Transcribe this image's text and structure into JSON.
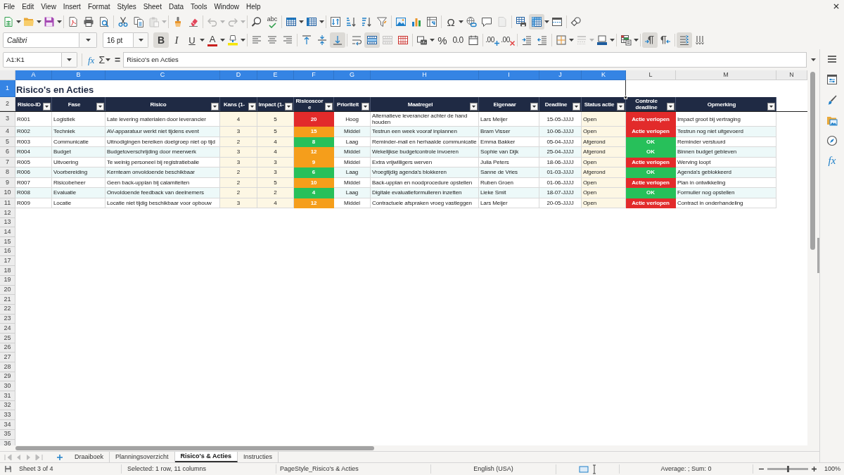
{
  "menu_bar": [
    "File",
    "Edit",
    "View",
    "Insert",
    "Format",
    "Styles",
    "Sheet",
    "Data",
    "Tools",
    "Window",
    "Help"
  ],
  "standard_toolbar": [
    [
      {
        "kind": "new_document",
        "on": false,
        "disabled": false
      },
      {
        "kind": "open",
        "on": false,
        "disabled": false
      },
      {
        "kind": "save",
        "on": false,
        "disabled": false
      }
    ],
    [
      {
        "kind": "export_pdf",
        "on": false,
        "disabled": false
      },
      {
        "kind": "print",
        "on": false,
        "disabled": false
      },
      {
        "kind": "print_preview",
        "on": false,
        "disabled": false
      }
    ],
    [
      {
        "kind": "cut",
        "on": false,
        "disabled": false
      },
      {
        "kind": "copy",
        "on": false,
        "disabled": false
      },
      {
        "kind": "paste",
        "on": false,
        "disabled": true
      }
    ],
    [
      {
        "kind": "clone_formatting",
        "on": false,
        "disabled": false
      },
      {
        "kind": "clear_formatting",
        "on": false,
        "disabled": false
      }
    ],
    [
      {
        "kind": "undo",
        "on": false,
        "disabled": true
      },
      {
        "kind": "redo",
        "on": false,
        "disabled": true
      }
    ],
    [
      {
        "kind": "find_replace",
        "on": false,
        "disabled": false
      },
      {
        "kind": "spelling",
        "text": "abc",
        "on": false,
        "disabled": false
      }
    ],
    [
      {
        "kind": "insert_rows",
        "on": false,
        "disabled": false
      },
      {
        "kind": "insert_columns",
        "on": false,
        "disabled": false
      }
    ],
    [
      {
        "kind": "sort",
        "on": false,
        "disabled": false
      },
      {
        "kind": "sort_ascending",
        "on": false,
        "disabled": false
      },
      {
        "kind": "sort_descending",
        "on": false,
        "disabled": false
      },
      {
        "kind": "autofilter",
        "on": false,
        "disabled": false
      }
    ],
    [
      {
        "kind": "image",
        "on": false,
        "disabled": false
      },
      {
        "kind": "chart",
        "on": false,
        "disabled": false
      },
      {
        "kind": "pivot_table",
        "on": false,
        "disabled": false
      }
    ],
    [
      {
        "kind": "special_character",
        "text": "Ω",
        "on": false,
        "disabled": false
      },
      {
        "kind": "hyperlink",
        "on": false,
        "disabled": false
      },
      {
        "kind": "comment",
        "on": false,
        "disabled": false
      },
      {
        "kind": "header_footer",
        "on": false,
        "disabled": true
      }
    ],
    [
      {
        "kind": "print_area",
        "on": false,
        "disabled": false
      },
      {
        "kind": "freeze",
        "on": true,
        "disabled": false
      },
      {
        "kind": "split_window",
        "on": false,
        "disabled": false
      }
    ],
    [
      {
        "kind": "draw_functions",
        "on": false,
        "disabled": false
      }
    ]
  ],
  "formatting_toolbar": {
    "font_name": "Calibri",
    "font_size": "16 pt",
    "groups": [
      [
        {
          "kind": "bold",
          "text": "B",
          "on": true,
          "disabled": false
        },
        {
          "kind": "italic",
          "text": "I",
          "on": false,
          "disabled": false
        },
        {
          "kind": "underline",
          "text": "U",
          "on": false,
          "disabled": false
        },
        {
          "kind": "font_color",
          "text": "A",
          "on": false,
          "disabled": false
        },
        {
          "kind": "highlight",
          "on": false,
          "disabled": false
        }
      ],
      [
        {
          "kind": "align_left",
          "on": false,
          "disabled": false
        },
        {
          "kind": "align_center",
          "on": false,
          "disabled": false
        },
        {
          "kind": "align_right",
          "on": false,
          "disabled": false
        }
      ],
      [
        {
          "kind": "align_top",
          "on": false,
          "disabled": false
        },
        {
          "kind": "align_middle",
          "on": false,
          "disabled": false
        },
        {
          "kind": "align_bottom",
          "on": true,
          "disabled": false
        }
      ],
      [
        {
          "kind": "wrap_text",
          "on": false,
          "disabled": false
        },
        {
          "kind": "merge_center",
          "on": true,
          "disabled": false
        },
        {
          "kind": "merge_cells",
          "on": false,
          "disabled": true
        },
        {
          "kind": "unmerge_cells",
          "on": false,
          "disabled": false
        }
      ],
      [
        {
          "kind": "number_format",
          "on": false,
          "disabled": false
        },
        {
          "kind": "percent_format",
          "text": "%",
          "on": false,
          "disabled": false
        },
        {
          "kind": "standard_format",
          "text": "0.0",
          "on": false,
          "disabled": false
        },
        {
          "kind": "date_format",
          "on": false,
          "disabled": false
        }
      ],
      [
        {
          "kind": "add_decimal",
          "text": ".00",
          "on": false,
          "disabled": false
        },
        {
          "kind": "delete_decimal",
          "text": ".00",
          "on": false,
          "disabled": false
        }
      ],
      [
        {
          "kind": "increase_indent",
          "on": false,
          "disabled": false
        },
        {
          "kind": "decrease_indent",
          "on": false,
          "disabled": false
        }
      ],
      [
        {
          "kind": "borders",
          "on": false,
          "disabled": false
        },
        {
          "kind": "border_style",
          "on": false,
          "disabled": true
        },
        {
          "kind": "border_color",
          "on": false,
          "disabled": false
        }
      ],
      [
        {
          "kind": "conditional_format",
          "on": false,
          "disabled": false
        }
      ],
      [
        {
          "kind": "left_to_right",
          "on": true,
          "disabled": false
        },
        {
          "kind": "right_to_left",
          "on": false,
          "disabled": false
        }
      ],
      [
        {
          "kind": "text_horizontal",
          "on": true,
          "disabled": false
        },
        {
          "kind": "text_vertical",
          "on": false,
          "disabled": false
        }
      ]
    ]
  },
  "formula_bar": {
    "name_box": "A1:K1",
    "function_wizard": "fx",
    "sum": "Σ",
    "formula": "=",
    "content": "Risico's en Acties"
  },
  "column_headers": [
    {
      "label": "A",
      "selected": true
    },
    {
      "label": "B",
      "selected": true
    },
    {
      "label": "C",
      "selected": true
    },
    {
      "label": "D",
      "selected": true
    },
    {
      "label": "E",
      "selected": true
    },
    {
      "label": "F",
      "selected": true
    },
    {
      "label": "G",
      "selected": true
    },
    {
      "label": "H",
      "selected": true
    },
    {
      "label": "I",
      "selected": true
    },
    {
      "label": "J",
      "selected": true
    },
    {
      "label": "K",
      "selected": true
    },
    {
      "label": "L",
      "selected": false
    },
    {
      "label": "M",
      "selected": false
    },
    {
      "label": "N",
      "selected": false
    }
  ],
  "row_headers": [
    {
      "label": "1",
      "selected": true
    },
    {
      "label": "2",
      "selected": false
    },
    {
      "label": "3",
      "selected": false
    },
    {
      "label": "4",
      "selected": false
    },
    {
      "label": "5",
      "selected": false
    },
    {
      "label": "6",
      "selected": false
    },
    {
      "label": "7",
      "selected": false
    },
    {
      "label": "8",
      "selected": false
    },
    {
      "label": "9",
      "selected": false
    },
    {
      "label": "10",
      "selected": false
    },
    {
      "label": "11",
      "selected": false
    },
    {
      "label": "12",
      "selected": false
    },
    {
      "label": "13",
      "selected": false
    },
    {
      "label": "14",
      "selected": false
    },
    {
      "label": "15",
      "selected": false
    },
    {
      "label": "16",
      "selected": false
    },
    {
      "label": "17",
      "selected": false
    },
    {
      "label": "18",
      "selected": false
    },
    {
      "label": "19",
      "selected": false
    },
    {
      "label": "20",
      "selected": false
    },
    {
      "label": "21",
      "selected": false
    },
    {
      "label": "22",
      "selected": false
    },
    {
      "label": "23",
      "selected": false
    },
    {
      "label": "24",
      "selected": false
    },
    {
      "label": "25",
      "selected": false
    },
    {
      "label": "26",
      "selected": false
    },
    {
      "label": "27",
      "selected": false
    },
    {
      "label": "28",
      "selected": false
    },
    {
      "label": "29",
      "selected": false
    },
    {
      "label": "30",
      "selected": false
    },
    {
      "label": "31",
      "selected": false
    },
    {
      "label": "32",
      "selected": false
    },
    {
      "label": "33",
      "selected": false
    },
    {
      "label": "34",
      "selected": false
    },
    {
      "label": "35",
      "selected": false
    },
    {
      "label": "36",
      "selected": false
    }
  ],
  "sheet": {
    "title": "Risico's en Acties",
    "table": {
      "columns": [
        "Risico-ID",
        "Fase",
        "Risico",
        "Kans (1-",
        "Impact (1-",
        "Risicoscore",
        "Prioriteit",
        "Maatregel",
        "Eigenaar",
        "Deadline",
        "Status actie",
        "Controle deadline",
        "Opmerking"
      ],
      "rows": [
        {
          "id": "R001",
          "phase": "Logistiek",
          "risk": "Late levering materialen door leverancier",
          "likelihood": "4",
          "impact": "5",
          "score": {
            "value": "20",
            "color": "#e22b2b"
          },
          "priority": "Hoog",
          "measure": "Alternatieve leverancier achter de hand houden",
          "owner": "Lars Meijer",
          "deadline": "15-05-JJJJ",
          "status": "Open",
          "deadline_check": {
            "value": "Actie verlopen",
            "color": "#e22b2b"
          },
          "remark": "Impact groot bij vertraging"
        },
        {
          "id": "R002",
          "phase": "Techniek",
          "risk": "AV-apparatuur werkt niet tijdens event",
          "likelihood": "3",
          "impact": "5",
          "score": {
            "value": "15",
            "color": "#f59e1b"
          },
          "priority": "Middel",
          "measure": "Testrun een week vooraf inplannen",
          "owner": "Bram Visser",
          "deadline": "10-06-JJJJ",
          "status": "Open",
          "deadline_check": {
            "value": "Actie verlopen",
            "color": "#e22b2b"
          },
          "remark": "Testrun nog niet uitgevoerd"
        },
        {
          "id": "R003",
          "phase": "Communicatie",
          "risk": "Uitnodigingen bereiken doelgroep niet op tijd",
          "likelihood": "2",
          "impact": "4",
          "score": {
            "value": "8",
            "color": "#27c05a"
          },
          "priority": "Laag",
          "measure": "Reminder-mail en herhaalde communicatie",
          "owner": "Emma Bakker",
          "deadline": "05-04-JJJJ",
          "status": "Afgerond",
          "deadline_check": {
            "value": "OK",
            "color": "#27c05a"
          },
          "remark": "Reminder verstuurd"
        },
        {
          "id": "R004",
          "phase": "Budget",
          "risk": "Budgetoverschrijding door meerwerk",
          "likelihood": "3",
          "impact": "4",
          "score": {
            "value": "12",
            "color": "#f59e1b"
          },
          "priority": "Middel",
          "measure": "Wekelijkse budgetcontrole invoeren",
          "owner": "Sophie van Dijk",
          "deadline": "25-04-JJJJ",
          "status": "Afgerond",
          "deadline_check": {
            "value": "OK",
            "color": "#27c05a"
          },
          "remark": "Binnen budget gebleven"
        },
        {
          "id": "R005",
          "phase": "Uitvoering",
          "risk": "Te weinig personeel bij registratiebalie",
          "likelihood": "3",
          "impact": "3",
          "score": {
            "value": "9",
            "color": "#f59e1b"
          },
          "priority": "Middel",
          "measure": "Extra vrijwilligers werven",
          "owner": "Julia Peters",
          "deadline": "18-06-JJJJ",
          "status": "Open",
          "deadline_check": {
            "value": "Actie verlopen",
            "color": "#e22b2b"
          },
          "remark": "Werving loopt"
        },
        {
          "id": "R006",
          "phase": "Voorbereiding",
          "risk": "Kernteam onvoldoende beschikbaar",
          "likelihood": "2",
          "impact": "3",
          "score": {
            "value": "6",
            "color": "#27c05a"
          },
          "priority": "Laag",
          "measure": "Vroegtijdig agenda's blokkeren",
          "owner": "Sanne de Vries",
          "deadline": "01-03-JJJJ",
          "status": "Afgerond",
          "deadline_check": {
            "value": "OK",
            "color": "#27c05a"
          },
          "remark": "Agenda's geblokkeerd"
        },
        {
          "id": "R007",
          "phase": "Risicobeheer",
          "risk": "Geen back-upplan bij calamiteiten",
          "likelihood": "2",
          "impact": "5",
          "score": {
            "value": "10",
            "color": "#f59e1b"
          },
          "priority": "Middel",
          "measure": "Back-upplan en noodprocedure opstellen",
          "owner": "Ruben Groen",
          "deadline": "01-06-JJJJ",
          "status": "Open",
          "deadline_check": {
            "value": "Actie verlopen",
            "color": "#e22b2b"
          },
          "remark": "Plan in ontwikkeling"
        },
        {
          "id": "R008",
          "phase": "Evaluatie",
          "risk": "Onvoldoende feedback van deelnemers",
          "likelihood": "2",
          "impact": "2",
          "score": {
            "value": "4",
            "color": "#27c05a"
          },
          "priority": "Laag",
          "measure": "Digitale evaluatieformulieren inzetten",
          "owner": "Lieke Smit",
          "deadline": "18-07-JJJJ",
          "status": "Open",
          "deadline_check": {
            "value": "OK",
            "color": "#27c05a"
          },
          "remark": "Formulier nog opstellen"
        },
        {
          "id": "R009",
          "phase": "Locatie",
          "risk": "Locatie niet tijdig beschikbaar voor opbouw",
          "likelihood": "3",
          "impact": "4",
          "score": {
            "value": "12",
            "color": "#f59e1b"
          },
          "priority": "Middel",
          "measure": "Contractuele afspraken vroeg vastleggen",
          "owner": "Lars Meijer",
          "deadline": "20-05-JJJJ",
          "status": "Open",
          "deadline_check": {
            "value": "Actie verlopen",
            "color": "#e22b2b"
          },
          "remark": "Contract in onderhandeling"
        }
      ]
    }
  },
  "sheet_tabs": [
    {
      "label": "Draaiboek",
      "selected": false
    },
    {
      "label": "Planningsoverzicht",
      "selected": false
    },
    {
      "label": "Risico's & Acties",
      "selected": true
    },
    {
      "label": "Instructies",
      "selected": false
    }
  ],
  "sidebar": {
    "functions": "fx"
  },
  "status_bar": {
    "sheet_position": "Sheet 3 of 4",
    "selection": "Selected: 1 row, 11 columns",
    "page_style": "PageStyle_Risico's & Acties",
    "language": "English (USA)",
    "summary": "Average: ; Sum: 0",
    "zoom": {
      "level": 0.5,
      "reading": "100%"
    }
  }
}
